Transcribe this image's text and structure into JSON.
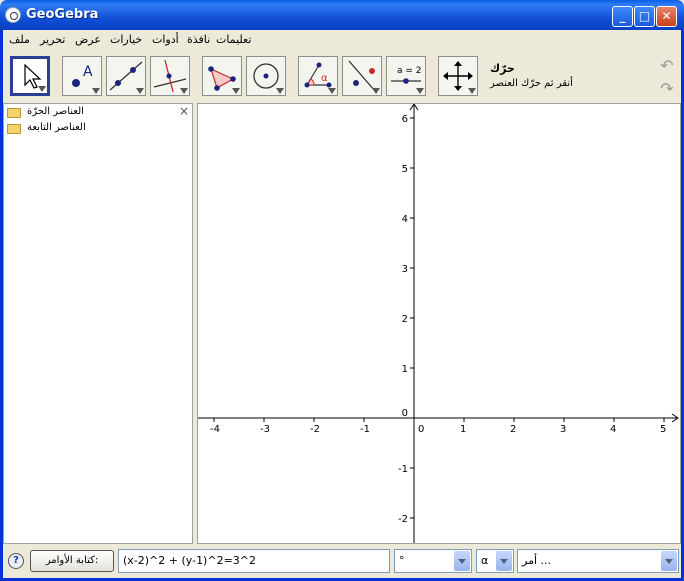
{
  "window": {
    "title": "GeoGebra",
    "minimize_label": "_",
    "maximize_label": "□",
    "close_label": "✕"
  },
  "menu": {
    "items": [
      "ملف",
      "تحرير",
      "عرض",
      "خيارات",
      "أدوات",
      "نافذة",
      "تعليمات"
    ]
  },
  "toolbar": {
    "tools": [
      {
        "name": "move-tool",
        "selected": true
      },
      {
        "name": "new-point-tool",
        "label": "A"
      },
      {
        "name": "line-through-two-points-tool"
      },
      {
        "name": "perpendicular-line-tool"
      },
      {
        "name": "polygon-tool"
      },
      {
        "name": "circle-with-center-tool"
      },
      {
        "name": "angle-tool",
        "label": "α"
      },
      {
        "name": "reflect-about-line-tool"
      },
      {
        "name": "slider-tool",
        "label": "a = 2"
      },
      {
        "name": "move-graphics-view-tool"
      }
    ],
    "help_title": "حرّك",
    "help_desc": "أنقر ثم حرّك العنصر",
    "undo_label": "↶",
    "redo_label": "↷"
  },
  "algebra": {
    "folders": [
      "العناصر الحرّة",
      "العناصر التابعة"
    ],
    "close_label": "×"
  },
  "graphics": {
    "x_ticks": [
      "-4",
      "-3",
      "-2",
      "-1",
      "0",
      "1",
      "2",
      "3",
      "4",
      "5"
    ],
    "y_ticks": [
      "6",
      "5",
      "4",
      "3",
      "2",
      "1",
      "0",
      "-1",
      "-2"
    ],
    "x_range": [
      -4.3,
      5.3
    ],
    "y_range": [
      -2.5,
      6.3
    ]
  },
  "inputbar": {
    "help_icon": "?",
    "input_button_label": "كتابة الأوامر:",
    "input_value": "(x-2)^2 + (y-1)^2=3^2",
    "symbol_combo_value": "°",
    "greek_combo_value": "α",
    "command_combo_value": "أمر ..."
  }
}
